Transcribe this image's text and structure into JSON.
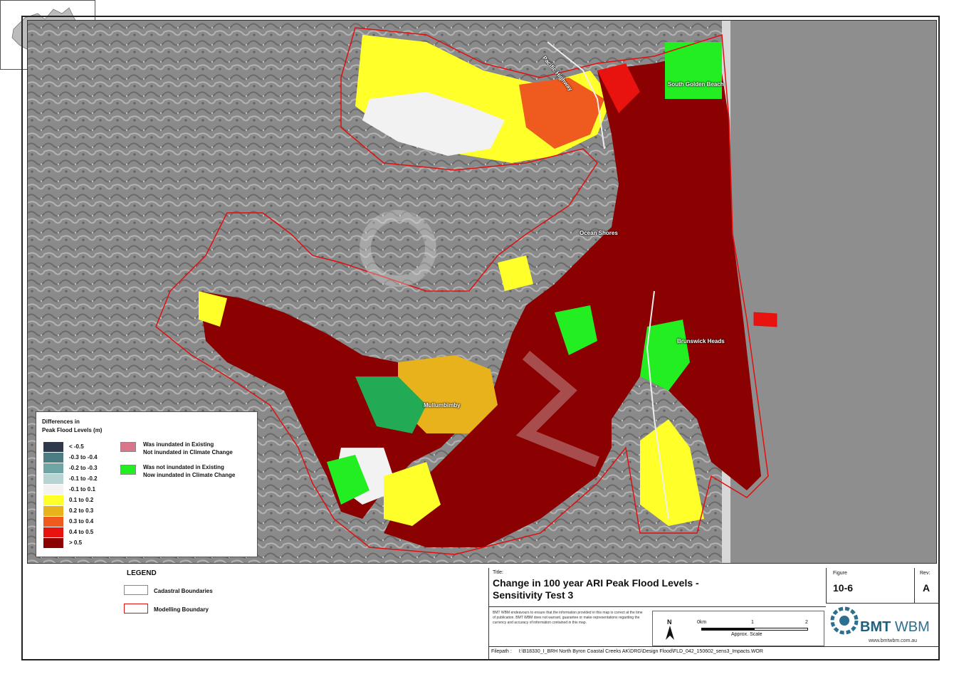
{
  "map": {
    "places": [
      {
        "name": "South Golden Beach"
      },
      {
        "name": "Ocean Shores"
      },
      {
        "name": "Brunswick Heads"
      },
      {
        "name": "Mullumbimby"
      },
      {
        "name": "Pacific Highway"
      }
    ]
  },
  "legend_main": {
    "title_line1": "Differences in",
    "title_line2": "Peak Flood Levels (m)",
    "classes": [
      {
        "label": "< -0.5",
        "color": "#2e3a4b"
      },
      {
        "label": "-0.3 to -0.4",
        "color": "#4c7d82"
      },
      {
        "label": "-0.2 to -0.3",
        "color": "#6fa5a4"
      },
      {
        "label": "-0.1 to -0.2",
        "color": "#b7d4d2"
      },
      {
        "label": "-0.1 to 0.1",
        "color": "#f2f2f2"
      },
      {
        "label": "0.1 to 0.2",
        "color": "#ffff2a"
      },
      {
        "label": "0.2 to 0.3",
        "color": "#e8b21c"
      },
      {
        "label": "0.3 to 0.4",
        "color": "#ef5a1e"
      },
      {
        "label": "0.4 to 0.5",
        "color": "#e8120f"
      },
      {
        "label": "> 0.5",
        "color": "#8b0000"
      }
    ],
    "categories": [
      {
        "line1": "Was inundated in Existing",
        "line2": "Not inundated in Climate Change",
        "color": "#d9768a"
      },
      {
        "line1": "Was not inundated in Existing",
        "line2": "Now inundated in Climate Change",
        "color": "#22ee22"
      }
    ]
  },
  "legend_bottom": {
    "heading": "LEGEND",
    "items": [
      {
        "label": "Cadastral Boundaries"
      },
      {
        "label": "Modelling Boundary"
      }
    ]
  },
  "title_block": {
    "title_label": "Title:",
    "title_line1": "Change in 100 year ARI Peak Flood Levels -",
    "title_line2": "Sensitivity Test 3",
    "disclaimer": "BMT WBM endeavours to ensure that the information provided in this map is correct at the time of publication. BMT WBM does not warrant, guarantee or make representations regarding the currency and accuracy of information contained in this map.",
    "figure_label": "Figure",
    "figure_value": "10-6",
    "rev_label": "Rev:",
    "rev_value": "A",
    "filepath_label": "Filepath :",
    "filepath_value": "I:\\B18330_I_BRH North Byron Coastal Creeks AK\\DRG\\Design Flood\\FLD_042_150602_sens3_Impacts.WOR"
  },
  "scale_bar": {
    "north": "N",
    "t0": "0km",
    "t1": "1",
    "t2": "2",
    "caption": "Approx. Scale"
  },
  "logo": {
    "brand_a": "BMT",
    "brand_b": "WBM",
    "url": "www.bmtwbm.com.au"
  }
}
